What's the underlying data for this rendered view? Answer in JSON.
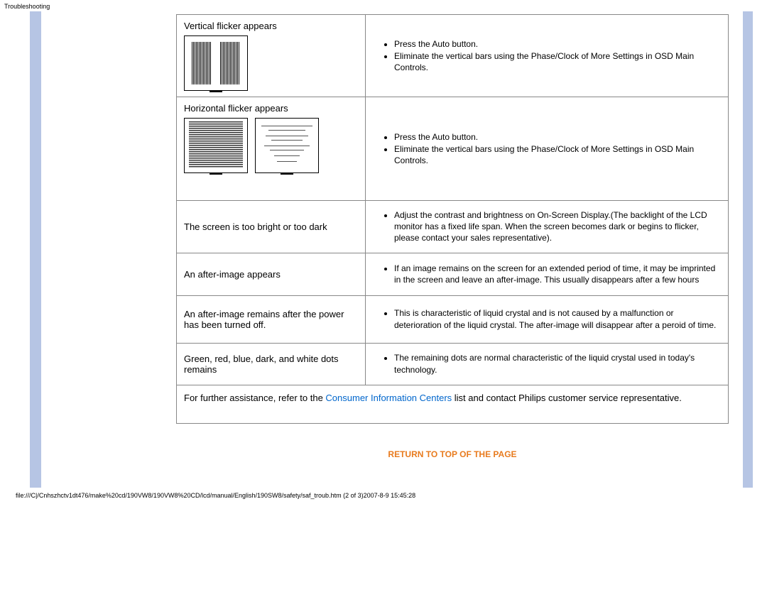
{
  "header": "Troubleshooting",
  "rows": [
    {
      "problem": "Vertical flicker appears",
      "solution": [
        "Press the Auto button.",
        "Eliminate the vertical bars using the Phase/Clock of More Settings in OSD Main Controls."
      ]
    },
    {
      "problem": "Horizontal flicker appears",
      "solution": [
        "Press the Auto button.",
        "Eliminate the vertical bars using the Phase/Clock of More Settings in OSD Main Controls."
      ]
    },
    {
      "problem": "The screen is too bright or too dark",
      "solution": [
        "Adjust the contrast and brightness on On-Screen Display.(The backlight of the LCD monitor has a fixed life span. When the screen becomes dark or begins to flicker, please contact your sales representative)."
      ]
    },
    {
      "problem": "An after-image appears",
      "solution": [
        "If an image remains on the screen for an extended period of time, it may be imprinted in the screen and leave an after-image. This usually disappears after a few hours"
      ]
    },
    {
      "problem": "An after-image remains after the power has been turned off.",
      "solution": [
        "This is characteristic of liquid crystal and is not caused by a malfunction or deterioration of the liquid crystal. The after-image will disappear after a peroid of time."
      ]
    },
    {
      "problem": "Green, red, blue, dark, and white dots remains",
      "solution": [
        "The remaining dots are normal characteristic of the liquid crystal used in today's technology."
      ]
    }
  ],
  "footer": {
    "prefix": "For further assistance, refer to the ",
    "link": "Consumer Information Centers",
    "suffix": " list and contact Philips customer service representative."
  },
  "returnLink": "RETURN TO TOP OF THE PAGE",
  "filePath": "file:///C|/Cnhszhctv1dt476/make%20cd/190VW8/190VW8%20CD/lcd/manual/English/190SW8/safety/saf_troub.htm (2 of 3)2007-8-9 15:45:28"
}
